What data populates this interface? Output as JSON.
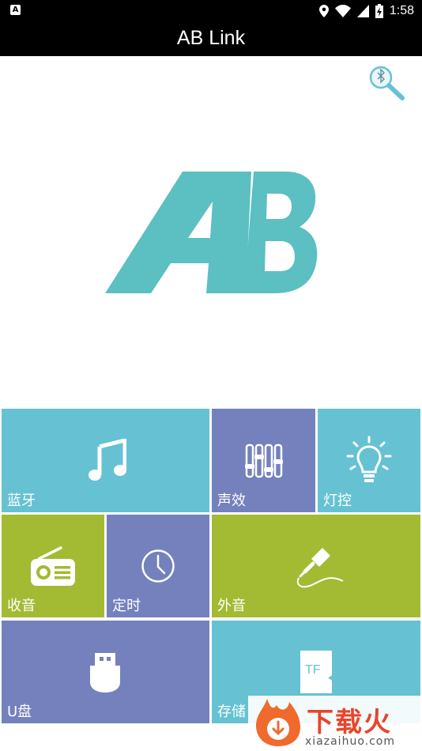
{
  "status_bar": {
    "app_badge": "A",
    "time": "1:58",
    "icons": [
      "location-icon",
      "wifi-icon",
      "signal-icon",
      "battery-charging-icon"
    ]
  },
  "header": {
    "title": "AB Link"
  },
  "logo": {
    "text": "AB",
    "color": "#5cbfc2"
  },
  "tiles": [
    {
      "label": "蓝牙",
      "icon": "music-note-icon",
      "color": "#66c2d2"
    },
    {
      "label": "声效",
      "icon": "equalizer-icon",
      "color": "#7481bd"
    },
    {
      "label": "灯控",
      "icon": "light-bulb-icon",
      "color": "#66c2d2"
    },
    {
      "label": "收音",
      "icon": "radio-icon",
      "color": "#a3ba33"
    },
    {
      "label": "定时",
      "icon": "clock-icon",
      "color": "#7481bd"
    },
    {
      "label": "外音",
      "icon": "aux-cable-icon",
      "color": "#a3ba33"
    },
    {
      "label": "U盘",
      "icon": "usb-drive-icon",
      "color": "#7481bd"
    },
    {
      "label": "存储",
      "icon": "tf-card-icon",
      "color": "#66c2d2",
      "icon_text": "TF"
    }
  ],
  "watermark": {
    "text": "下载火",
    "url": "xiazaihuo.com"
  },
  "colors": {
    "cyan": "#66c2d2",
    "violet": "#7481bd",
    "green": "#a3ba33",
    "bar": "#000000"
  }
}
